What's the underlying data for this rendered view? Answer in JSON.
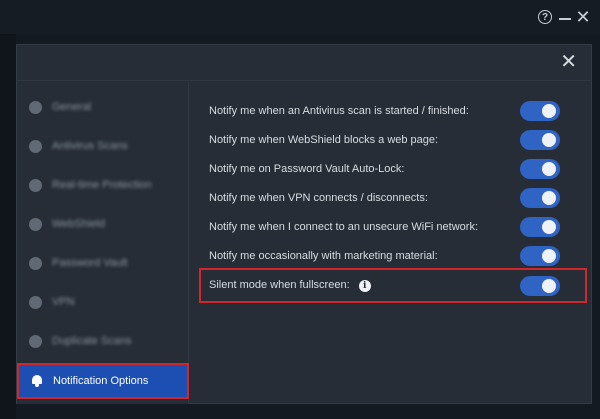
{
  "window": {
    "help_icon": "question-circle-icon",
    "minimize_icon": "minimize-icon",
    "close_icon": "close-icon"
  },
  "dialog": {
    "close_icon": "close-icon"
  },
  "sidebar": {
    "items": [
      {
        "label": "General",
        "icon": "general-icon"
      },
      {
        "label": "Antivirus Scans",
        "icon": "antivirus-icon"
      },
      {
        "label": "Real-time Protection",
        "icon": "shield-icon"
      },
      {
        "label": "WebShield",
        "icon": "webshield-icon"
      },
      {
        "label": "Password Vault",
        "icon": "vault-icon"
      },
      {
        "label": "VPN",
        "icon": "vpn-icon"
      },
      {
        "label": "Duplicate Scans",
        "icon": "duplicate-icon"
      },
      {
        "label": "Notification Options",
        "icon": "bell-icon",
        "active": true
      }
    ]
  },
  "settings": {
    "rows": [
      {
        "label": "Notify me when an Antivirus scan is started / finished:",
        "enabled": true
      },
      {
        "label": "Notify me when WebShield blocks a web page:",
        "enabled": true
      },
      {
        "label": "Notify me on Password Vault Auto-Lock:",
        "enabled": true
      },
      {
        "label": "Notify me when VPN connects / disconnects:",
        "enabled": true
      },
      {
        "label": "Notify me when I connect to an unsecure WiFi network:",
        "enabled": true
      },
      {
        "label": "Notify me occasionally with marketing material:",
        "enabled": true
      },
      {
        "label": "Silent mode when fullscreen:",
        "enabled": true,
        "info_icon": "i"
      }
    ]
  },
  "colors": {
    "accent": "#2f63c4",
    "active_item": "#1d4fb3",
    "highlight": "#d0262c"
  }
}
